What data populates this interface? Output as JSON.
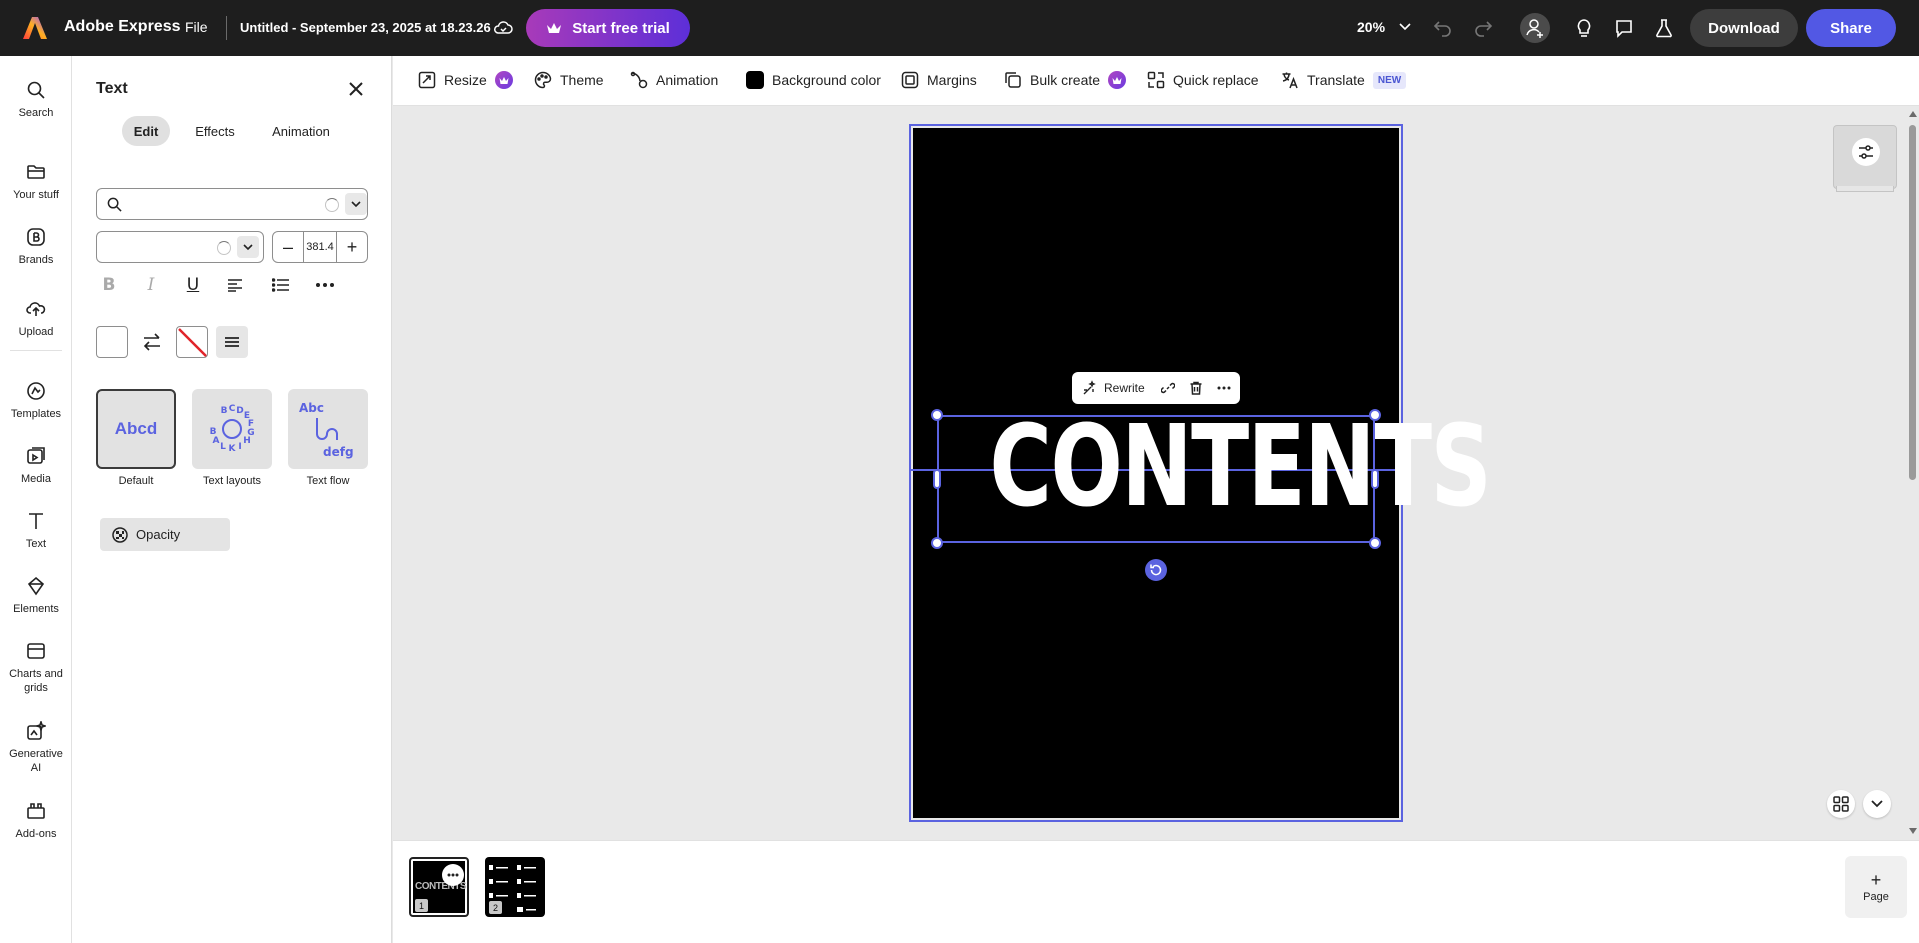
{
  "header": {
    "app_name": "Adobe Express",
    "file_menu": "File",
    "doc_title": "Untitled - September 23, 2025 at 18.23.26",
    "trial_button": "Start free trial",
    "zoom": "20%",
    "download_button": "Download",
    "share_button": "Share"
  },
  "rail": {
    "items": [
      {
        "label": "Search",
        "icon": "search-icon"
      },
      {
        "label": "Your stuff",
        "icon": "folder-icon"
      },
      {
        "label": "Brands",
        "icon": "brand-icon"
      },
      {
        "label": "Upload",
        "icon": "upload-icon"
      },
      {
        "label": "Templates",
        "icon": "templates-icon"
      },
      {
        "label": "Media",
        "icon": "media-icon"
      },
      {
        "label": "Text",
        "icon": "text-icon"
      },
      {
        "label": "Elements",
        "icon": "elements-icon"
      },
      {
        "label": "Charts and grids",
        "icon": "charts-icon"
      },
      {
        "label": "Generative AI",
        "icon": "sparkle-icon"
      },
      {
        "label": "Add-ons",
        "icon": "addons-icon"
      }
    ]
  },
  "panel": {
    "title": "Text",
    "tabs": [
      "Edit",
      "Effects",
      "Animation"
    ],
    "font_search_value": "",
    "font_style_value": "",
    "font_size": "381.4",
    "styles": [
      {
        "label": "Default",
        "preview": "Abcd"
      },
      {
        "label": "Text layouts",
        "preview": "ABCDEFGHIJKL"
      },
      {
        "label": "Text flow",
        "preview_top": "Abc",
        "preview_bottom": "defg"
      }
    ],
    "opacity_label": "Opacity"
  },
  "toolbar": {
    "resize": "Resize",
    "theme": "Theme",
    "animation": "Animation",
    "background_color": "Background color",
    "margins": "Margins",
    "bulk_create": "Bulk create",
    "quick_replace": "Quick replace",
    "translate": "Translate",
    "new_badge": "NEW"
  },
  "canvas": {
    "headline_text": "CONTENTS",
    "context_menu": {
      "rewrite": "Rewrite"
    },
    "page_background": "#000000",
    "accent_color": "#5b63e0"
  },
  "pages": {
    "thumb1_text": "CONTENTS",
    "thumb1_number": "1",
    "thumb2_number": "2",
    "add_page_label": "Page"
  },
  "colors": {
    "topbar": "#1e1e1e",
    "share": "#5258e4",
    "trial_gradient_start": "#a83ab9",
    "trial_gradient_end": "#5d2fd8"
  }
}
